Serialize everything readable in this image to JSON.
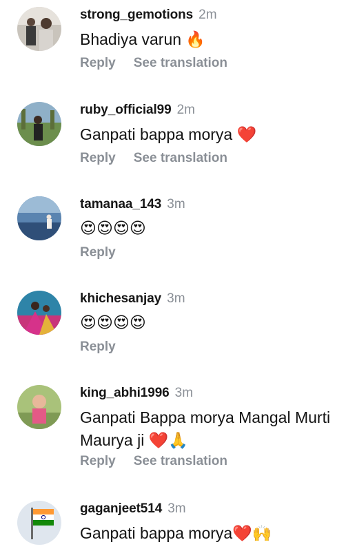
{
  "comments": [
    {
      "username": "strong_gemotions",
      "time": "2m",
      "text": "Bhadiya varun 🔥",
      "reply": "Reply",
      "translate": "See translation"
    },
    {
      "username": "ruby_official99",
      "time": "2m",
      "text": "Ganpati bappa morya ❤️",
      "reply": "Reply",
      "translate": "See translation"
    },
    {
      "username": "tamanaa_143",
      "time": "3m",
      "text": "😍😍😍😍",
      "reply": "Reply"
    },
    {
      "username": "khichesanjay",
      "time": "3m",
      "text": "😍😍😍😍",
      "reply": "Reply"
    },
    {
      "username": "king_abhi1996",
      "time": "3m",
      "text": "Ganpati Bappa morya Mangal Murti Maurya ji ❤️🙏",
      "reply": "Reply",
      "translate": "See translation"
    },
    {
      "username": "gaganjeet514",
      "time": "3m",
      "text": "Ganpati bappa morya❤️🙌"
    }
  ]
}
